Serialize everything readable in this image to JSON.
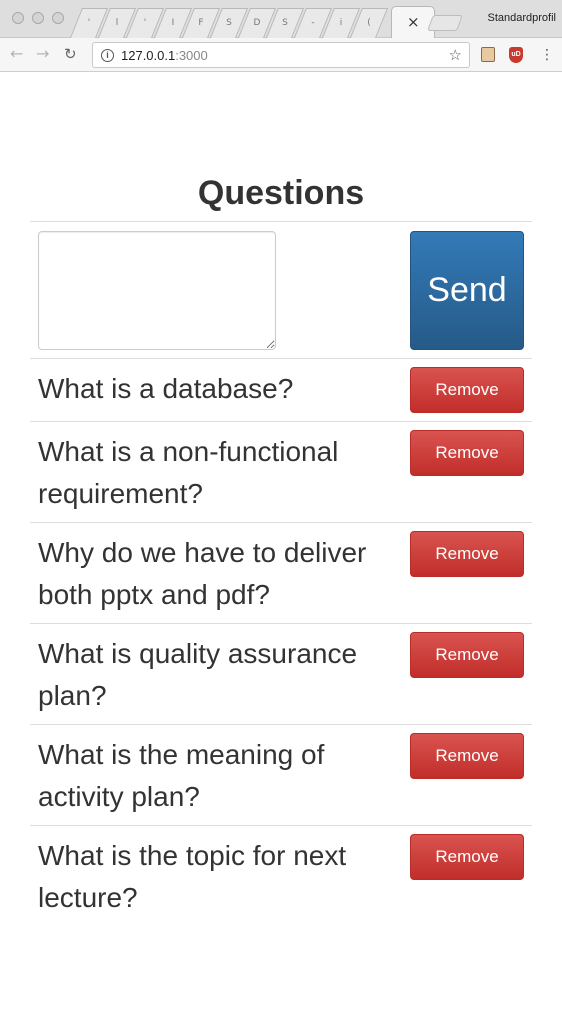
{
  "browser": {
    "tabs": [
      "'",
      "l",
      "'",
      "I",
      "F",
      "S",
      "D",
      "S",
      "-",
      "i",
      "("
    ],
    "close_glyph": "×",
    "profile_name": "Standardprofil",
    "url_host": "127.0.0.1",
    "url_port": ":3000",
    "ext_badge": "uD"
  },
  "page": {
    "title": "Questions",
    "input": {
      "value": "",
      "placeholder": ""
    },
    "send_label": "Send",
    "remove_label": "Remove",
    "questions": [
      "What is a database?",
      "What is a non-functional requirement?",
      "Why do we have to deliver both pptx and pdf?",
      "What is quality assurance plan?",
      "What is the meaning of activity plan?",
      "What is the topic for next lecture?"
    ]
  },
  "colors": {
    "send": "#2d6ca2",
    "remove": "#d2322d",
    "text": "#333333"
  }
}
